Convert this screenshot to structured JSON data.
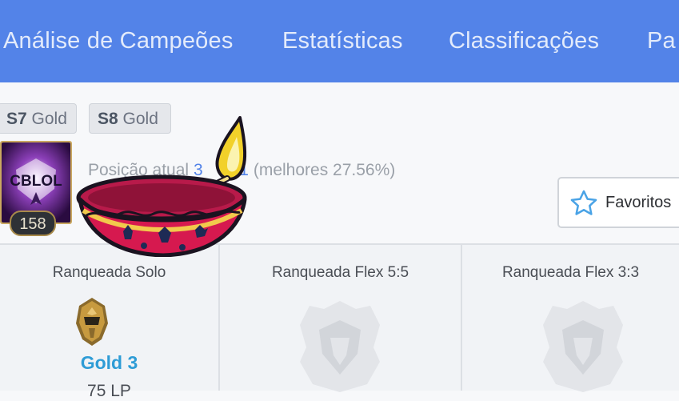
{
  "nav": {
    "tabs": [
      "Análise de Campeões",
      "Estatísticas",
      "Classificações",
      "Pa"
    ]
  },
  "seasons": [
    {
      "season": "S7",
      "tier": "Gold"
    },
    {
      "season": "S8",
      "tier": "Gold"
    }
  ],
  "profile": {
    "emblem_text": "CBLOL",
    "level": "158",
    "rank_prefix": "Posição atual",
    "rank_link_a": "3",
    "rank_link_b": "21",
    "rank_suffix": "(melhores 27.56%)"
  },
  "favorite_button": {
    "label": "Favoritos",
    "icon": "star-icon"
  },
  "queues": [
    {
      "title": "Ranqueada Solo",
      "tier": "Gold 3",
      "lp": "75 LP",
      "ranked": true
    },
    {
      "title": "Ranqueada Flex 5:5",
      "ranked": false
    },
    {
      "title": "Ranqueada Flex 3:3",
      "ranked": false
    }
  ],
  "colors": {
    "nav_bg": "#5383e8",
    "tier_text": "#2e9cd6",
    "link": "#5383e8"
  }
}
